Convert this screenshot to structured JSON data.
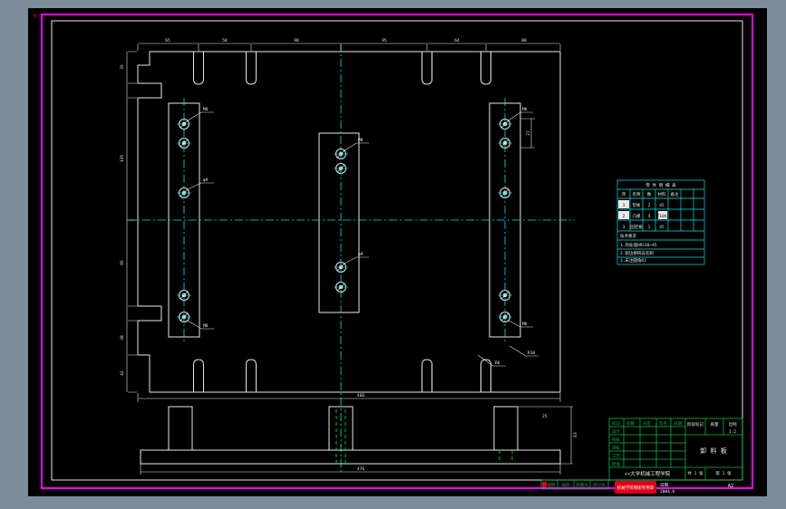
{
  "colors": {
    "bg": "#7d8c9b",
    "canvas": "#000000",
    "line": "#e9e9e9",
    "magenta": "#ff00ff",
    "center": "#00e5e5",
    "hidden": "#00dd00",
    "green": "#00bb44",
    "red": "#e00016"
  },
  "texts": {
    "marker": "✕",
    "dims": {
      "top": [
        "65",
        "58",
        "98",
        "95",
        "64",
        "80"
      ],
      "left": [
        "35",
        "135",
        "95",
        "38",
        "42"
      ],
      "right": "27",
      "width_main": "466",
      "front_width": "476",
      "front_height": "63",
      "front_offset": "25"
    },
    "holes": {
      "l1": "M8",
      "l3": "φ9",
      "l5": "M8",
      "m1": "M8",
      "m3": "φ9",
      "r1": "M8",
      "r5": "M8",
      "br1": "R6",
      "br2": "R10"
    },
    "table": {
      "title": "零 件 明 细 表",
      "headers": [
        "序",
        "名称",
        "数",
        "材料",
        "备注"
      ],
      "r1": [
        "1",
        "垫板",
        "2",
        "45"
      ],
      "r2": [
        "2",
        "凸模",
        "4",
        "T10A"
      ],
      "r3": [
        "3",
        "固定板",
        "1",
        "45"
      ],
      "notes_title": "技术要求",
      "note1": "1.热处理HRC40~45",
      "note2": "2.锐边倒钝去毛刺",
      "note3": "3.未注圆角R3"
    },
    "titleblock": {
      "h1": "标记",
      "h2": "处数",
      "h3": "分区",
      "h4": "签名",
      "h5": "日期",
      "r1": "设计",
      "r2": "校核",
      "r3": "审核",
      "r4": "工艺",
      "r5": "批准",
      "stage": "阶段标记",
      "mass": "质量",
      "scale": "比例",
      "scale_val": "1:2",
      "part": "卸 料 板",
      "sheets": "共 1 张",
      "sheet": "第 1 张",
      "org": "××大学机械工程学院"
    },
    "strip": {
      "c1": "描图",
      "c2": "描校",
      "c3": "底图号",
      "c4": "装订号"
    },
    "stamp": {
      "seal": "机械学院制图专用章",
      "line1": "日期",
      "line2": "2004.6",
      "code": "A2"
    }
  }
}
